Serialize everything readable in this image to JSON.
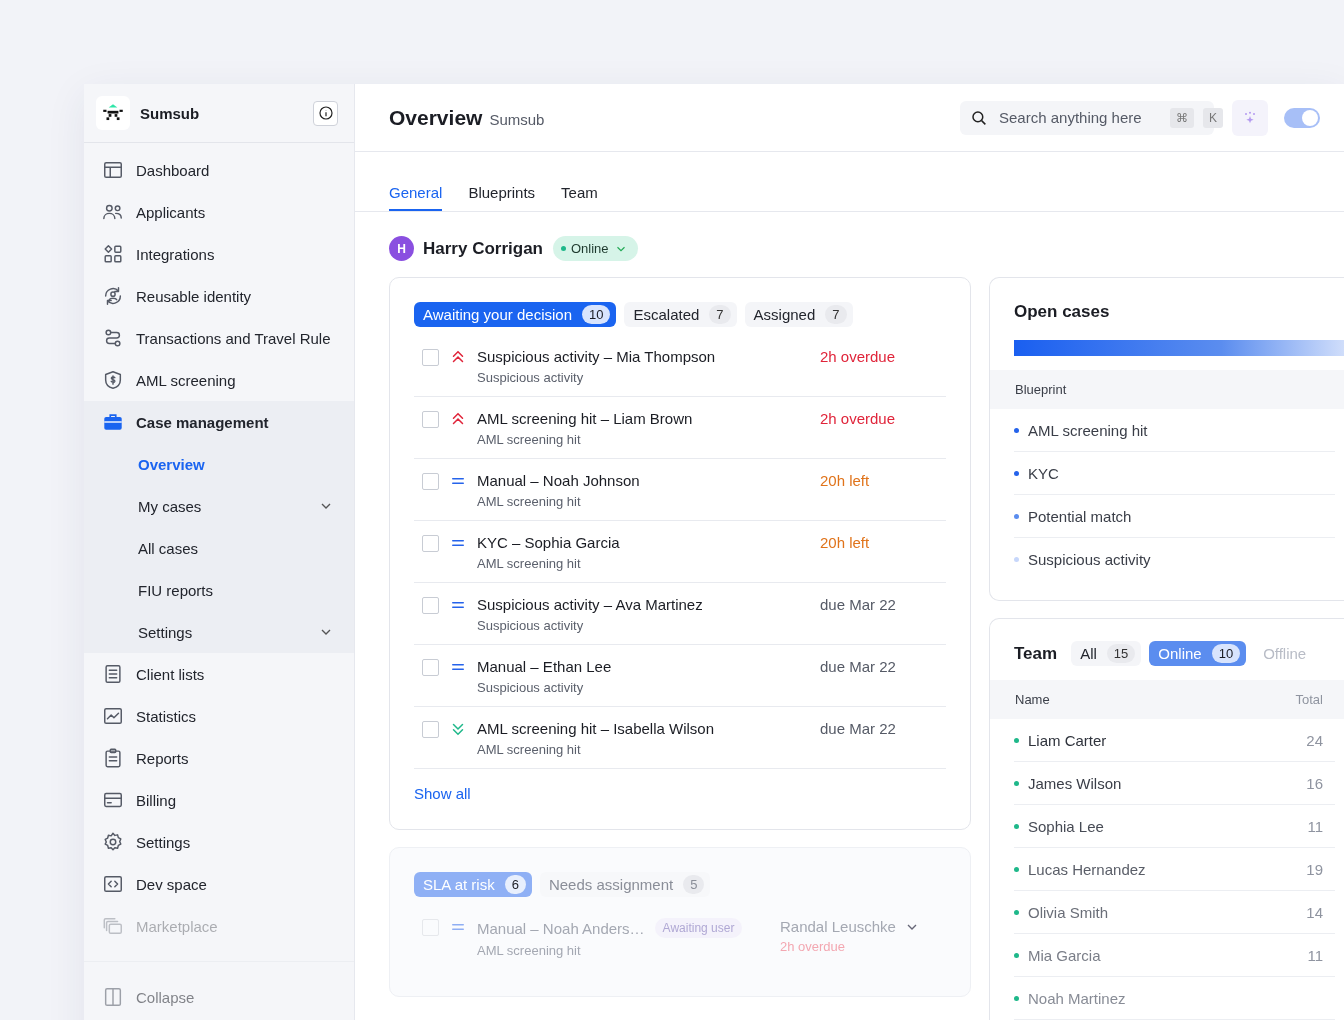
{
  "brand": {
    "name": "Sumsub"
  },
  "sidebar": {
    "items": [
      {
        "label": "Dashboard",
        "selected": false
      },
      {
        "label": "Applicants",
        "selected": false
      },
      {
        "label": "Integrations",
        "selected": false
      },
      {
        "label": "Reusable identity",
        "selected": false
      },
      {
        "label": "Transactions and Travel Rule",
        "selected": false
      },
      {
        "label": "AML screening",
        "selected": false
      },
      {
        "label": "Case management",
        "selected": true,
        "children": [
          {
            "label": "Overview",
            "selected": true,
            "expandable": false
          },
          {
            "label": "My cases",
            "selected": false,
            "expandable": true
          },
          {
            "label": "All cases",
            "selected": false,
            "expandable": false
          },
          {
            "label": "FIU reports",
            "selected": false,
            "expandable": false
          },
          {
            "label": "Settings",
            "selected": false,
            "expandable": true
          }
        ]
      },
      {
        "label": "Client lists",
        "selected": false
      },
      {
        "label": "Statistics",
        "selected": false
      },
      {
        "label": "Reports",
        "selected": false
      },
      {
        "label": "Billing",
        "selected": false
      },
      {
        "label": "Settings",
        "selected": false
      },
      {
        "label": "Dev space",
        "selected": false
      },
      {
        "label": "Marketplace",
        "selected": false
      }
    ],
    "footer": "Collapse"
  },
  "header": {
    "title": "Overview",
    "subtitle": "Sumsub",
    "search": {
      "placeholder": "Search anything here",
      "keys": [
        "⌘",
        "K"
      ]
    },
    "toggle": {
      "on": true
    }
  },
  "tabs": [
    {
      "label": "General",
      "selected": true
    },
    {
      "label": "Blueprints",
      "selected": false
    },
    {
      "label": "Team",
      "selected": false
    }
  ],
  "user": {
    "initial": "H",
    "name": "Harry Corrigan",
    "status": "Online"
  },
  "cases": {
    "filters": [
      {
        "label": "Awaiting your decision",
        "count": "10",
        "selected": true
      },
      {
        "label": "Escalated",
        "count": "7",
        "selected": false
      },
      {
        "label": "Assigned",
        "count": "7",
        "selected": false
      }
    ],
    "rows": [
      {
        "title": "Suspicious activity – Mia Thompson",
        "subtitle": "Suspicious activity",
        "kind": "high",
        "due": {
          "text": "2h overdue",
          "color": "#e0243a"
        },
        "checked": false
      },
      {
        "title": "AML screening hit – Liam Brown",
        "subtitle": "AML screening hit",
        "kind": "high",
        "due": {
          "text": "2h overdue",
          "color": "#e0243a"
        },
        "checked": false
      },
      {
        "title": "Manual – Noah Johnson",
        "subtitle": "AML screening hit",
        "kind": "medium",
        "due": {
          "text": "20h left",
          "color": "#e0731a"
        },
        "checked": false
      },
      {
        "title": "KYC – Sophia Garcia",
        "subtitle": "AML screening hit",
        "kind": "medium",
        "due": {
          "text": "20h left",
          "color": "#e0731a"
        },
        "checked": false
      },
      {
        "title": "Suspicious activity – Ava Martinez",
        "subtitle": "Suspicious activity",
        "kind": "medium",
        "due": {
          "text": "due Mar 22",
          "color": "#555a66"
        },
        "checked": false
      },
      {
        "title": "Manual – Ethan Lee",
        "subtitle": "Suspicious activity",
        "kind": "medium",
        "due": {
          "text": "due Mar 22",
          "color": "#555a66"
        },
        "checked": false
      },
      {
        "title": "AML screening hit – Isabella Wilson",
        "subtitle": "AML screening hit",
        "kind": "low",
        "due": {
          "text": "due Mar 22",
          "color": "#555a66"
        },
        "checked": false
      }
    ],
    "show_all": "Show all"
  },
  "sla": {
    "filters": [
      {
        "label": "SLA at risk",
        "count": "6",
        "selected": true
      },
      {
        "label": "Needs assignment",
        "count": "5",
        "selected": false
      }
    ],
    "rows": [
      {
        "title": "Manual – Noah Anders…",
        "badge": "Awaiting user",
        "assignee": "Randal Leuschke",
        "subtitle": "AML screening hit",
        "kind": "medium",
        "due": {
          "text": "2h overdue",
          "color": "#f3a7b1"
        },
        "checked": false
      }
    ]
  },
  "open_cases": {
    "title": "Open cases",
    "bar": {
      "level": 1
    },
    "column": "Blueprint",
    "items": [
      {
        "label": "AML screening hit",
        "color": "#2563eb"
      },
      {
        "label": "KYC",
        "color": "#2563eb"
      },
      {
        "label": "Potential match",
        "color": "#5b8def"
      },
      {
        "label": "Suspicious activity",
        "color": "#c7d7fb"
      }
    ]
  },
  "team": {
    "title": "Team",
    "filters": [
      {
        "label": "All",
        "count": "15",
        "selected": false
      },
      {
        "label": "Online",
        "count": "10",
        "selected": true
      },
      {
        "label": "Offline",
        "selected": false
      }
    ],
    "columns": [
      "Name",
      "Total"
    ],
    "members": [
      {
        "name": "Liam Carter",
        "total": "24",
        "color": "#1fb88a"
      },
      {
        "name": "James Wilson",
        "total": "16",
        "color": "#1fb88a"
      },
      {
        "name": "Sophia Lee",
        "total": "11",
        "color": "#1fb88a"
      },
      {
        "name": "Lucas Hernandez",
        "total": "19",
        "color": "#1fb88a"
      },
      {
        "name": "Olivia Smith",
        "total": "14",
        "color": "#1fb88a"
      },
      {
        "name": "Mia Garcia",
        "total": "11",
        "color": "#1fb88a"
      },
      {
        "name": "Noah Martinez",
        "color": "#1fb88a"
      }
    ]
  }
}
